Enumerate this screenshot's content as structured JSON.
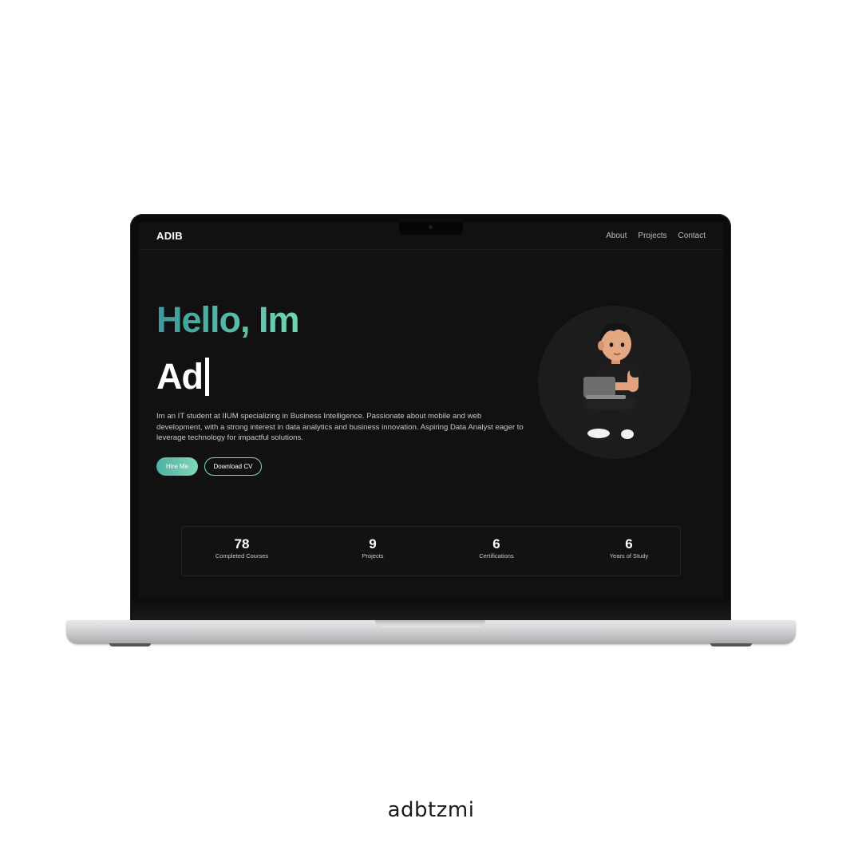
{
  "nav": {
    "brand": "ADIB",
    "links": [
      "About",
      "Projects",
      "Contact"
    ]
  },
  "hero": {
    "greeting": "Hello, Im",
    "typed_text": "Ad",
    "bio": "Im an IT student at IIUM specializing in Business Intelligence. Passionate about mobile and web development, with a strong interest in data analytics and business innovation. Aspiring Data Analyst eager to leverage technology for impactful solutions.",
    "primary_button": "Hire Me",
    "secondary_button": "Download CV"
  },
  "stats": [
    {
      "value": "78",
      "label": "Completed Courses"
    },
    {
      "value": "9",
      "label": "Projects"
    },
    {
      "value": "6",
      "label": "Certifications"
    },
    {
      "value": "6",
      "label": "Years of Study"
    }
  ],
  "colors": {
    "accent_start": "#3b9a9b",
    "accent_end": "#6fd6b4",
    "background": "#111111"
  },
  "footer": {
    "watermark": "adbtzmi"
  }
}
